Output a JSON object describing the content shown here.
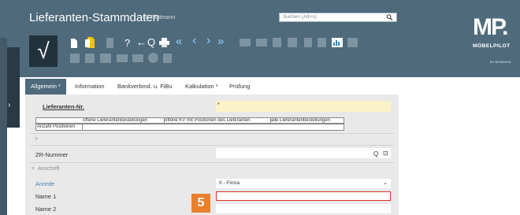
{
  "header": {
    "title": "Lieferanten-Stammdaten",
    "user": "Uli Flottmann",
    "search_placeholder": "Suchen (Alt+s)",
    "background": "#4e6a7b"
  },
  "toolbar": {
    "confirm_glyph": "√",
    "question_glyph": "?",
    "undo_glyph": "←",
    "zoom_glyph": "Q",
    "nav_first_glyph": "«",
    "nav_prev_glyph": "‹",
    "nav_next_glyph": "›",
    "nav_last_glyph": "»"
  },
  "logo": {
    "main": "MP.",
    "sub": "MÖBELPILOT",
    "by": "BY BEWIDATA"
  },
  "tabs": [
    {
      "label": "Allgemein *",
      "active": true
    },
    {
      "label": "Information",
      "active": false
    },
    {
      "label": "Bankverbind. u. FiBu",
      "active": false
    },
    {
      "label": "Kalkulation *",
      "active": false
    },
    {
      "label": "Prüfung",
      "active": false
    }
  ],
  "form": {
    "lieferanten_nr_label": "Lieferanten-Nr.",
    "required_marker": "*",
    "grid_headers": [
      "offene Lieferantenbestellungen",
      "offene KV mit Positionen des Lieferanten",
      "alle Lieferantenbestellungen"
    ],
    "grid_row_label": "Anzahl Positionen",
    "section_chevron": ">",
    "zr_label": "ZR-Nummer",
    "zr_search_glyph": "Q",
    "zr_list_glyph": "⊡",
    "anschrift_label": "Anschrift",
    "anrede_label": "Anrede",
    "anrede_value": "II - Firma",
    "name1_label": "Name 1",
    "name2_label": "Name 2"
  },
  "step_badge": "5",
  "colors": {
    "accent": "#4e6a7b",
    "required_field": "#fbf2c8",
    "highlight_border": "#d9342b",
    "step_badge": "#e8802e"
  }
}
